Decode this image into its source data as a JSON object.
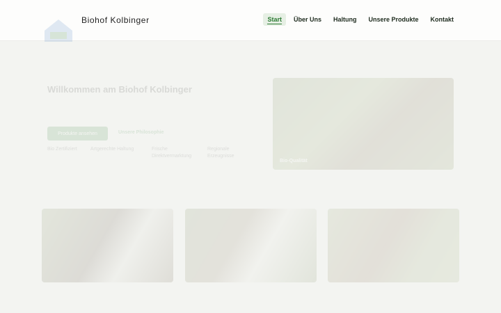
{
  "header": {
    "site_title": "Biohof Kolbinger",
    "logo_icon": "farm-logo-icon"
  },
  "nav": {
    "items": [
      {
        "label": "Start",
        "active": true
      },
      {
        "label": "Über Uns",
        "active": false
      },
      {
        "label": "Haltung",
        "active": false
      },
      {
        "label": "Unsere Produkte",
        "active": false
      },
      {
        "label": "Kontakt",
        "active": false
      }
    ]
  },
  "hero": {
    "title": "Willkommen am Biohof Kolbinger",
    "primary_button": "Produkte ansehen",
    "secondary_link": "Unsere Philosophie",
    "features": [
      "Bio Zertifiziert",
      "Artgerechte Haltung",
      "Frische Direktvermarktung",
      "Regionale Erzeugnisse"
    ],
    "image_badge": "Bio-Qualität"
  },
  "colors": {
    "accent": "#2c7a33",
    "background": "#f3f4f1",
    "header": "#fdfdfc"
  }
}
